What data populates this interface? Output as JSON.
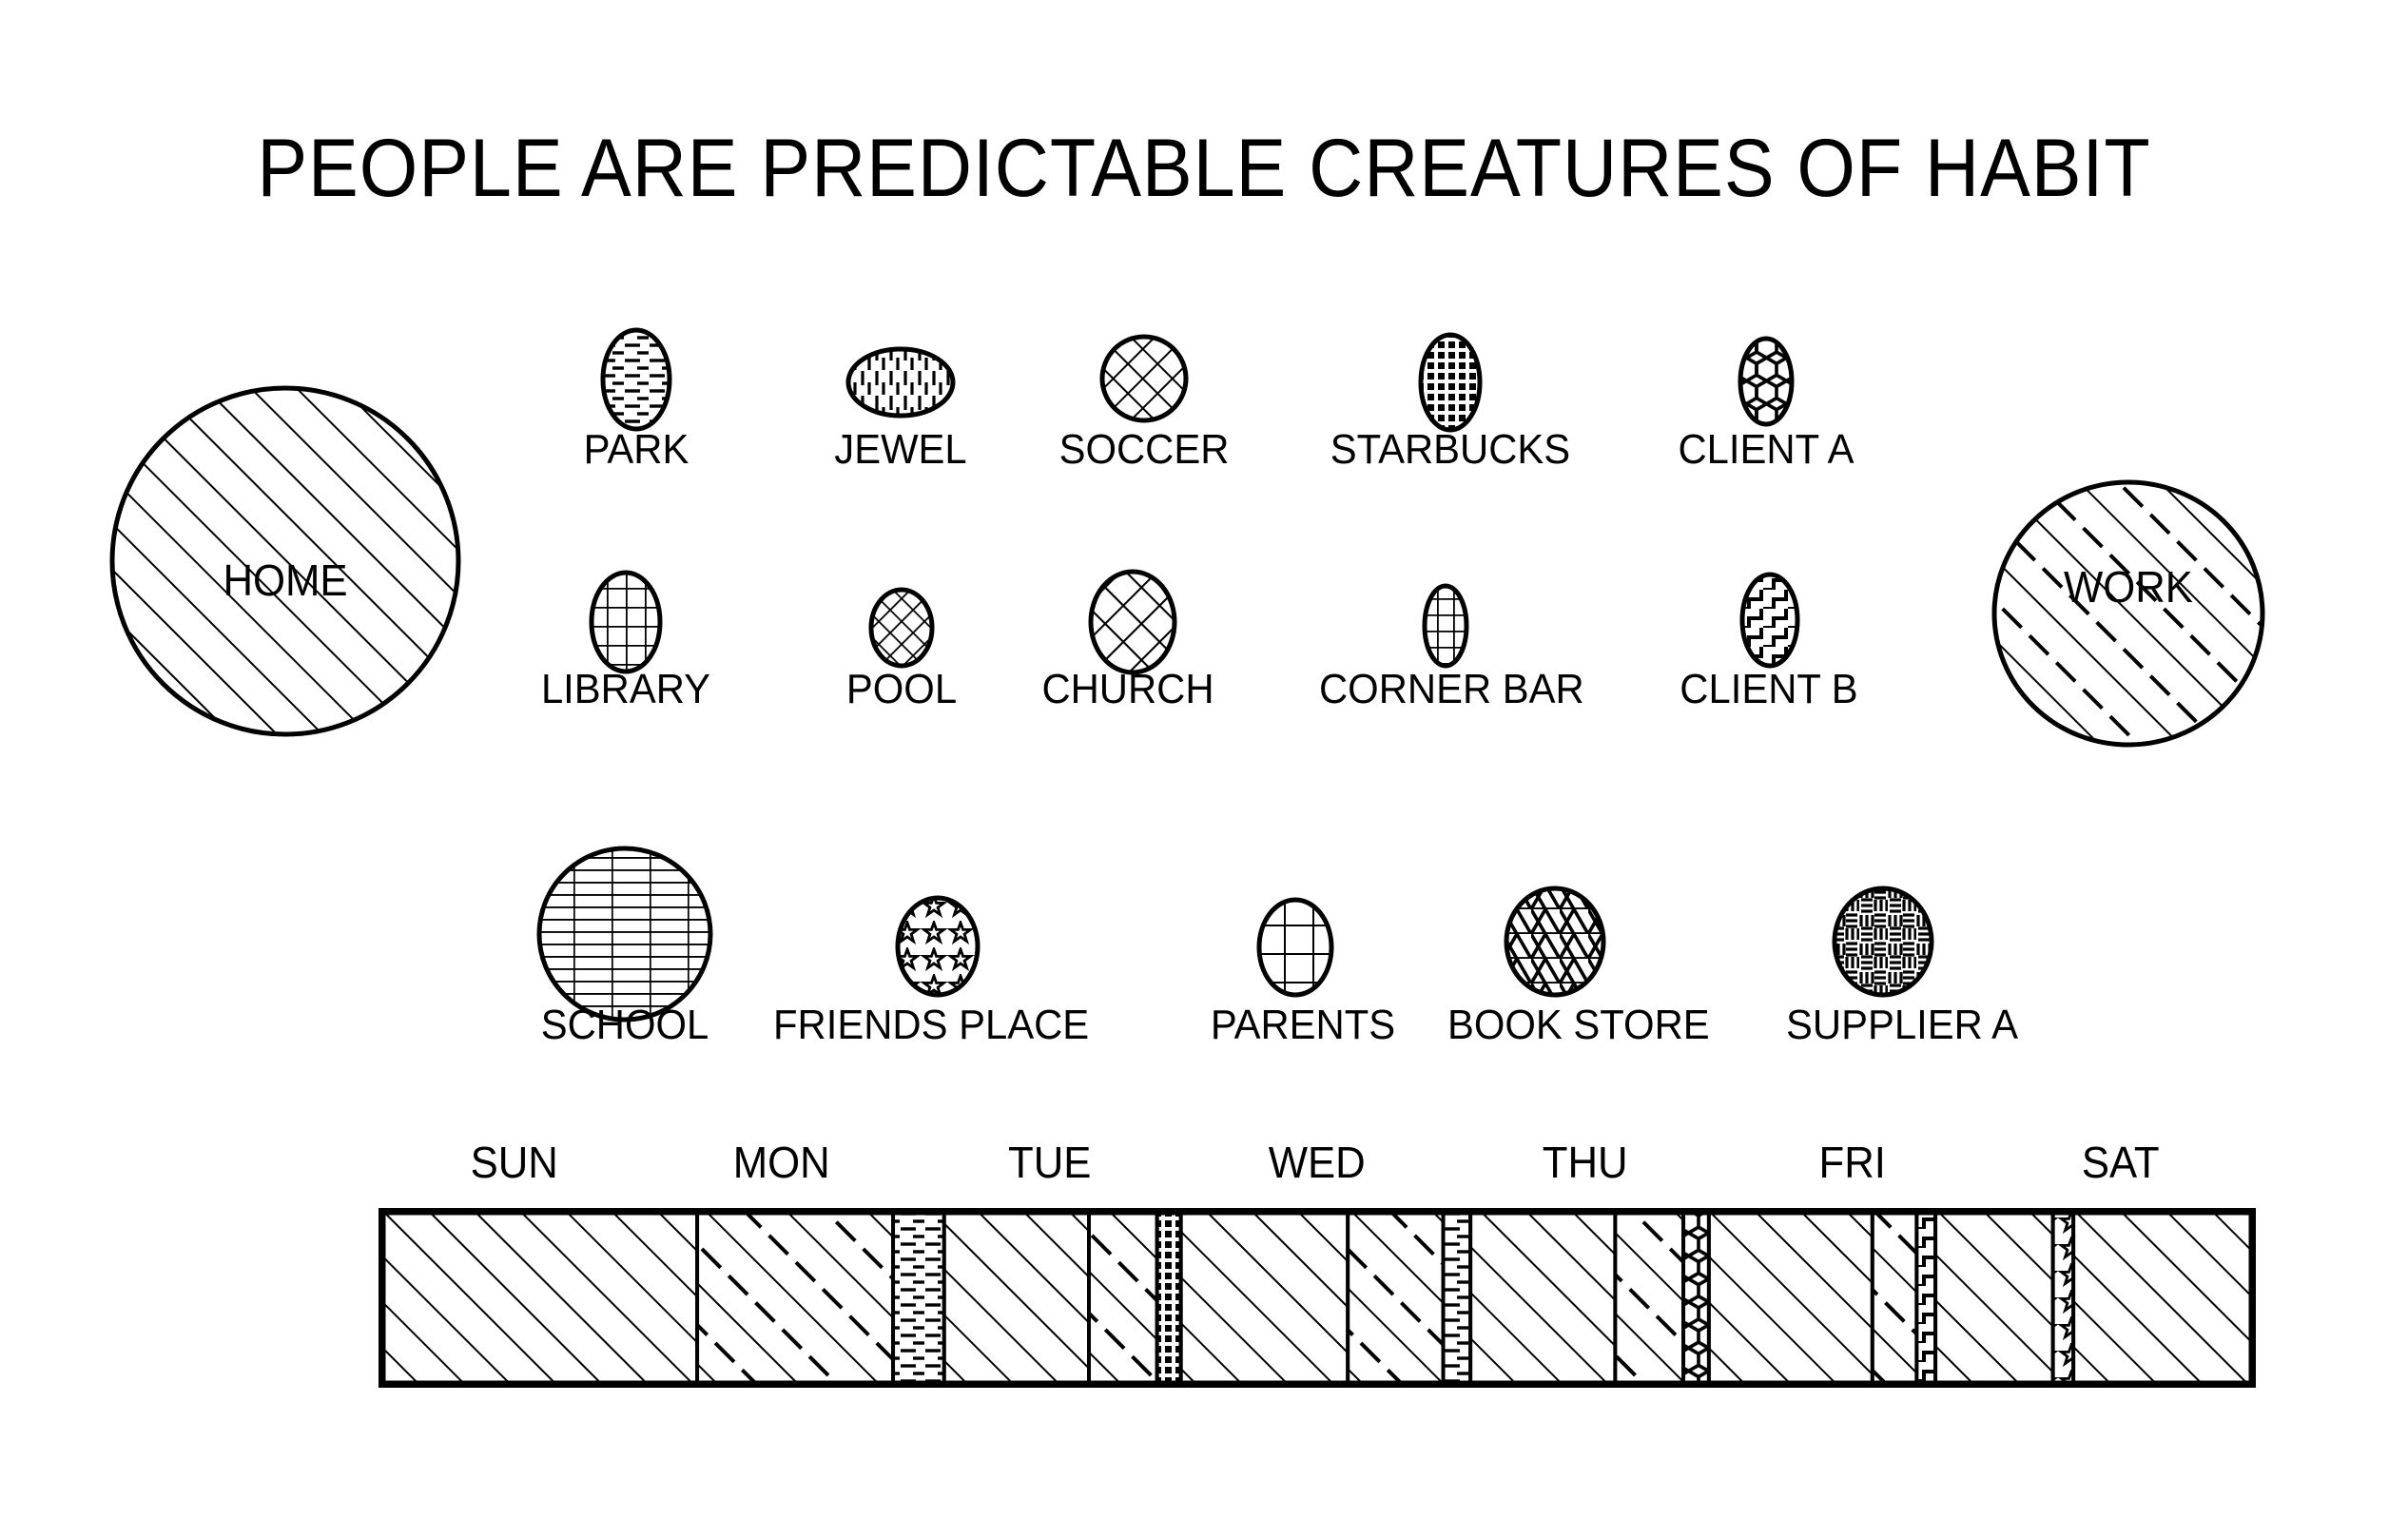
{
  "title": "PEOPLE ARE PREDICTABLE CREATURES OF HABIT",
  "anchors": [
    {
      "id": "home",
      "label": "HOME",
      "pattern": "diagonal-solid-hatch",
      "shape": "circle"
    },
    {
      "id": "work",
      "label": "WORK",
      "pattern": "diagonal-alternating-dash-hatch",
      "shape": "circle"
    }
  ],
  "places": [
    {
      "id": "park",
      "label": "PARK",
      "pattern": "horizontal-brick",
      "shape": "ellipse-tall",
      "row": 1
    },
    {
      "id": "jewel",
      "label": "JEWEL",
      "pattern": "vertical-dash",
      "shape": "ellipse-wide",
      "row": 1
    },
    {
      "id": "soccer",
      "label": "SOCCER",
      "pattern": "diagonal-crosshatch",
      "shape": "circle-small",
      "row": 1
    },
    {
      "id": "starbucks",
      "label": "STARBUCKS",
      "pattern": "fine-grid-dots",
      "shape": "ellipse-tall",
      "row": 1
    },
    {
      "id": "client-a",
      "label": "CLIENT A",
      "pattern": "honeycomb",
      "shape": "ellipse-tall",
      "row": 1
    },
    {
      "id": "library",
      "label": "LIBRARY",
      "pattern": "square-grid",
      "shape": "ellipse-tall",
      "row": 2
    },
    {
      "id": "pool",
      "label": "POOL",
      "pattern": "diagonal-crosshatch-fine",
      "shape": "ellipse-small",
      "row": 2
    },
    {
      "id": "church",
      "label": "CHURCH",
      "pattern": "diagonal-crosshatch-wide",
      "shape": "ellipse-tall",
      "row": 2
    },
    {
      "id": "corner-bar",
      "label": "CORNER BAR",
      "pattern": "small-grid",
      "shape": "ellipse-narrow",
      "row": 2
    },
    {
      "id": "client-b",
      "label": "CLIENT B",
      "pattern": "zigzag",
      "shape": "ellipse-tall",
      "row": 2
    },
    {
      "id": "school",
      "label": "SCHOOL",
      "pattern": "dense-horizontal-lines",
      "shape": "circle-big",
      "row": 3
    },
    {
      "id": "friends-place",
      "label": "FRIENDS PLACE",
      "pattern": "stars",
      "shape": "ellipse-tall",
      "row": 3
    },
    {
      "id": "parents",
      "label": "PARENTS",
      "pattern": "large-grid",
      "shape": "ellipse-tall",
      "row": 3
    },
    {
      "id": "book-store",
      "label": "BOOK STORE",
      "pattern": "triangular-mesh",
      "shape": "circle-med",
      "row": 3
    },
    {
      "id": "supplier-a",
      "label": "SUPPLIER A",
      "pattern": "basketweave",
      "shape": "circle-med",
      "row": 3
    }
  ],
  "timeline": {
    "days": [
      "SUN",
      "MON",
      "TUE",
      "WED",
      "THU",
      "FRI",
      "SAT"
    ],
    "segments": [
      {
        "place_id": "home",
        "label": "HOME",
        "pattern": "diagonal-solid-hatch",
        "width_pct": 18.6
      },
      {
        "place_id": "work",
        "label": "WORK",
        "pattern": "diagonal-alternating-dash-hatch",
        "width_pct": 11.5
      },
      {
        "place_id": "park",
        "label": "PARK",
        "pattern": "horizontal-brick",
        "width_pct": 3.0
      },
      {
        "place_id": "home",
        "label": "HOME",
        "pattern": "diagonal-solid-hatch",
        "width_pct": 8.5
      },
      {
        "place_id": "work",
        "label": "WORK",
        "pattern": "diagonal-alternating-dash-hatch",
        "width_pct": 4.0
      },
      {
        "place_id": "starbucks",
        "label": "STARBUCKS",
        "pattern": "fine-grid-dots",
        "width_pct": 1.4
      },
      {
        "place_id": "home",
        "label": "HOME",
        "pattern": "diagonal-solid-hatch",
        "width_pct": 9.8
      },
      {
        "place_id": "work",
        "label": "WORK",
        "pattern": "diagonal-alternating-dash-hatch",
        "width_pct": 5.6
      },
      {
        "place_id": "park",
        "label": "PARK",
        "pattern": "horizontal-brick",
        "width_pct": 1.6
      },
      {
        "place_id": "home",
        "label": "HOME",
        "pattern": "diagonal-solid-hatch",
        "width_pct": 8.5
      },
      {
        "place_id": "work",
        "label": "WORK",
        "pattern": "diagonal-alternating-dash-hatch",
        "width_pct": 4.0
      },
      {
        "place_id": "client-a",
        "label": "CLIENT A",
        "pattern": "honeycomb",
        "width_pct": 1.5
      },
      {
        "place_id": "home",
        "label": "HOME",
        "pattern": "diagonal-solid-hatch",
        "width_pct": 9.6
      },
      {
        "place_id": "work",
        "label": "WORK",
        "pattern": "diagonal-alternating-dash-hatch",
        "width_pct": 2.6
      },
      {
        "place_id": "client-b",
        "label": "CLIENT B",
        "pattern": "zigzag",
        "width_pct": 1.1
      },
      {
        "place_id": "home",
        "label": "HOME",
        "pattern": "diagonal-solid-hatch",
        "width_pct": 6.9
      },
      {
        "place_id": "friends-place",
        "label": "FRIENDS PLACE",
        "pattern": "stars",
        "width_pct": 1.2
      },
      {
        "place_id": "home",
        "label": "HOME",
        "pattern": "diagonal-solid-hatch",
        "width_pct": 10.6
      }
    ]
  },
  "colors": {
    "ink": "#000000",
    "paper": "#ffffff"
  }
}
